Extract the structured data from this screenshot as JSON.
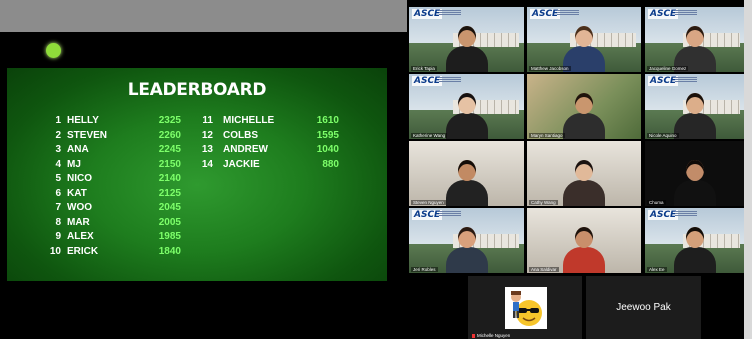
{
  "leaderboard": {
    "title": "LEADERBOARD",
    "left": [
      {
        "rank": "1",
        "name": "HELLY",
        "score": "2325"
      },
      {
        "rank": "2",
        "name": "STEVEN",
        "score": "2260"
      },
      {
        "rank": "3",
        "name": "ANA",
        "score": "2245"
      },
      {
        "rank": "4",
        "name": "MJ",
        "score": "2150"
      },
      {
        "rank": "5",
        "name": "NICO",
        "score": "2140"
      },
      {
        "rank": "6",
        "name": "KAT",
        "score": "2125"
      },
      {
        "rank": "7",
        "name": "WOO",
        "score": "2045"
      },
      {
        "rank": "8",
        "name": "MAR",
        "score": "2005"
      },
      {
        "rank": "9",
        "name": "ALEX",
        "score": "1985"
      },
      {
        "rank": "10",
        "name": "ERICK",
        "score": "1840"
      }
    ],
    "right": [
      {
        "rank": "11",
        "name": "MICHELLE",
        "score": "1610"
      },
      {
        "rank": "12",
        "name": "COLBS",
        "score": "1595"
      },
      {
        "rank": "13",
        "name": "ANDREW",
        "score": "1040"
      },
      {
        "rank": "14",
        "name": "JACKIE",
        "score": "880"
      }
    ]
  },
  "brand": {
    "logo_text": "ASCE"
  },
  "participants": [
    {
      "name": "Erick Tapia",
      "skin": "#c9956e",
      "hair": "#1a120c",
      "shirt": "#1d1d1d",
      "bg": "campus"
    },
    {
      "name": "Matthew Jacobson",
      "skin": "#e2b596",
      "hair": "#4a2f1b",
      "shirt": "#2a3f6a",
      "bg": "campus"
    },
    {
      "name": "Jacqueline Gomez",
      "skin": "#d9a684",
      "hair": "#2a1a10",
      "shirt": "#303030",
      "bg": "campus"
    },
    {
      "name": "Katherine Wang",
      "skin": "#e6c2a4",
      "hair": "#151010",
      "shirt": "#1f1f1f",
      "bg": "campus"
    },
    {
      "name": "Maryn Santiago",
      "skin": "#c9966e",
      "hair": "#1e140c",
      "shirt": "#2d2d2d",
      "bg": "palm"
    },
    {
      "name": "Nicole Aquino",
      "skin": "#dcae8a",
      "hair": "#1a110b",
      "shirt": "#262626",
      "bg": "campus"
    },
    {
      "name": "Steven Nguyen",
      "skin": "#c28a63",
      "hair": "#140d08",
      "shirt": "#222",
      "bg": "room"
    },
    {
      "name": "Cathy Wang",
      "skin": "#e1b999",
      "hair": "#1a1210",
      "shirt": "#3a2e2a",
      "bg": "room"
    },
    {
      "name": "Chuma",
      "skin": "#c28c69",
      "hair": "#100a07",
      "shirt": "#111",
      "bg": "dark"
    },
    {
      "name": "Jeri Robles",
      "skin": "#d9a07c",
      "hair": "#2a1a12",
      "shirt": "#2f3a4a",
      "bg": "campus"
    },
    {
      "name": "Ana Saldivar",
      "skin": "#c98f6b",
      "hair": "#1d120c",
      "shirt": "#c0392b",
      "bg": "room"
    },
    {
      "name": "Alex Ee",
      "skin": "#d4a07a",
      "hair": "#130d08",
      "shirt": "#1e1e1e",
      "bg": "campus"
    }
  ],
  "audio_tiles": [
    {
      "name": "Michelle Nguyen",
      "avatar": "emoji"
    },
    {
      "name": "Jeewoo Pak"
    }
  ]
}
